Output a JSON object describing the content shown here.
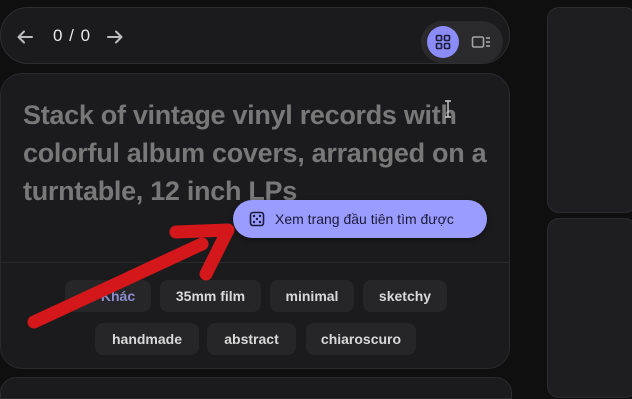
{
  "nav": {
    "counter": "0 / 0",
    "back_icon": "arrow-left-icon",
    "forward_icon": "arrow-right-icon",
    "view_toggle": {
      "grid_icon": "grid-icon",
      "list_icon": "list-icon",
      "active": "grid"
    }
  },
  "card": {
    "prompt_text": "Stack of vintage vinyl records with colorful album covers, arranged on a turntable, 12 inch LPs",
    "cta_label": "Xem trang đầu tiên tìm được",
    "cta_icon": "dice-icon",
    "chips": [
      {
        "label": "Khác"
      },
      {
        "label": "35mm film"
      },
      {
        "label": "minimal"
      },
      {
        "label": "sketchy"
      },
      {
        "label": "handmade"
      },
      {
        "label": "abstract"
      },
      {
        "label": "chiaroscuro"
      }
    ]
  },
  "colors": {
    "accent": "#9a9cff",
    "annotation_arrow": "#d4171a"
  }
}
